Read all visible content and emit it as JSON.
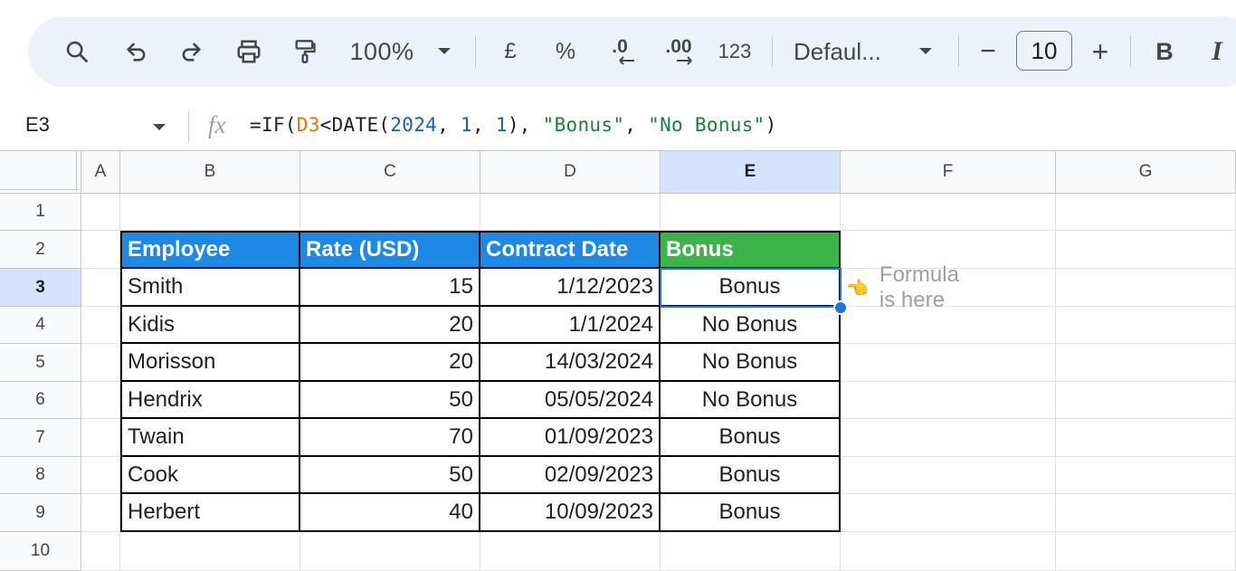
{
  "toolbar": {
    "icons": [
      "search-icon",
      "undo-icon",
      "redo-icon",
      "print-icon",
      "paint-format-icon"
    ],
    "zoom": "100%",
    "currency": "£",
    "percent": "%",
    "decrease_decimal": ".0",
    "increase_decimal": ".00",
    "number_format": "123",
    "font": "Defaul...",
    "font_size": "10",
    "decrease_font": "−",
    "increase_font": "+",
    "bold": "B",
    "italic": "I"
  },
  "formula_bar": {
    "cell_ref": "E3",
    "fx": "fx",
    "formula_parts": {
      "p1": "=IF(",
      "ref": "D3",
      "p2": "<DATE(",
      "n1": "2024",
      "c1": ", ",
      "n2": "1",
      "c2": ", ",
      "n3": "1",
      "p3": "), ",
      "s1": "\"Bonus\"",
      "c3": ", ",
      "s2": "\"No Bonus\"",
      "p4": ")"
    }
  },
  "columns": [
    "A",
    "B",
    "C",
    "D",
    "E",
    "F",
    "G"
  ],
  "rows": [
    "1",
    "2",
    "3",
    "4",
    "5",
    "6",
    "7",
    "8",
    "9",
    "10"
  ],
  "selected_cell": "E3",
  "table": {
    "headers": [
      "Employee",
      "Rate (USD)",
      "Contract Date",
      "Bonus"
    ],
    "header_colors": [
      "#1e88e5",
      "#1e88e5",
      "#1e88e5",
      "#3bb54a"
    ],
    "rows": [
      [
        "Smith",
        "15",
        "1/12/2023",
        "Bonus"
      ],
      [
        "Kidis",
        "20",
        "1/1/2024",
        "No Bonus"
      ],
      [
        "Morisson",
        "20",
        "14/03/2024",
        "No Bonus"
      ],
      [
        "Hendrix",
        "50",
        "05/05/2024",
        "No Bonus"
      ],
      [
        "Twain",
        "70",
        "01/09/2023",
        "Bonus"
      ],
      [
        "Cook",
        "50",
        "02/09/2023",
        "Bonus"
      ],
      [
        "Herbert",
        "40",
        "10/09/2023",
        "Bonus"
      ]
    ]
  },
  "note": "Formula is here",
  "note_icon": "pointing-hand-icon"
}
